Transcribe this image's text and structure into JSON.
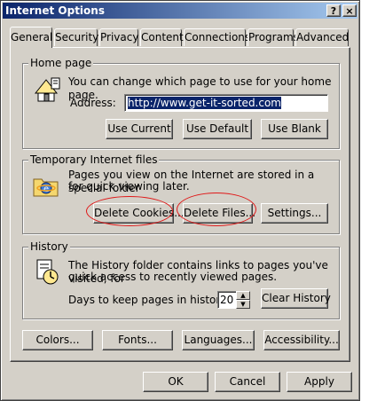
{
  "window": {
    "title": "Internet Options",
    "help_label": "?",
    "close_label": "×"
  },
  "tabs": [
    "General",
    "Security",
    "Privacy",
    "Content",
    "Connections",
    "Programs",
    "Advanced"
  ],
  "home_page": {
    "group_label": "Home page",
    "description": "You can change which page to use for your home page.",
    "address_label": "Address:",
    "address_value": "http://www.get-it-sorted.com",
    "use_current": "Use Current",
    "use_default": "Use Default",
    "use_blank": "Use Blank"
  },
  "temp_files": {
    "group_label": "Temporary Internet files",
    "description_line1": "Pages you view on the Internet are stored in a special folder",
    "description_line2": "for quick viewing later.",
    "delete_cookies": "Delete Cookies...",
    "delete_files": "Delete Files...",
    "settings": "Settings..."
  },
  "history": {
    "group_label": "History",
    "description_line1": "The History folder contains links to pages you've visited, for",
    "description_line2": "quick access to recently viewed pages.",
    "days_label": "Days to keep pages in history:",
    "days_value": "20",
    "clear_history": "Clear History"
  },
  "bottom_buttons": {
    "colors": "Colors...",
    "fonts": "Fonts...",
    "languages": "Languages...",
    "accessibility": "Accessibility..."
  },
  "dialog_buttons": {
    "ok": "OK",
    "cancel": "Cancel",
    "apply": "Apply"
  },
  "colors": {
    "titlebar": "#0a246a",
    "face": "#d4d0c8",
    "annotation": "#e01818"
  },
  "icons": [
    "home-icon",
    "ie-folder-icon",
    "history-clock-icon"
  ]
}
